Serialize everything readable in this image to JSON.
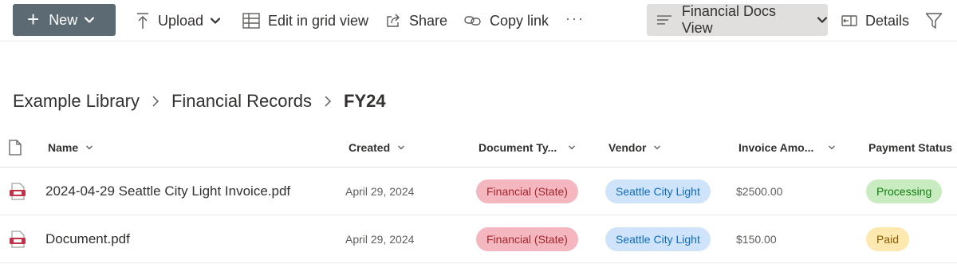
{
  "colors": {
    "new_button_bg": "#5c6b73",
    "view_selector_bg": "#e1dfdd",
    "doc_type_pill_bg": "#f5b7bf",
    "doc_type_pill_text": "#a4262c",
    "vendor_pill_bg": "#cfe4fa",
    "vendor_pill_text": "#0f6cbd",
    "status_processing_bg": "#c8ebc0",
    "status_processing_text": "#107c10",
    "status_paid_bg": "#fde9b0",
    "status_paid_text": "#8a5a00",
    "pdf_icon": "#c4314b"
  },
  "toolbar": {
    "new_label": "New",
    "upload_label": "Upload",
    "edit_grid_label": "Edit in grid view",
    "share_label": "Share",
    "copy_link_label": "Copy link",
    "more_label": "···",
    "view_label": "Financial Docs View",
    "details_label": "Details",
    "icons": [
      "plus-icon",
      "upload-icon",
      "grid-icon",
      "share-icon",
      "link-icon",
      "more-icon",
      "view-lines-icon",
      "details-icon",
      "filter-icon",
      "chevron-down-icon"
    ]
  },
  "breadcrumb": {
    "items": [
      "Example Library",
      "Financial Records"
    ],
    "current": "FY24"
  },
  "list": {
    "columns": {
      "name": "Name",
      "created": "Created",
      "doc_type": "Document Ty...",
      "vendor": "Vendor",
      "amount": "Invoice Amo...",
      "status": "Payment Status"
    },
    "rows": [
      {
        "name": "2024-04-29 Seattle City Light Invoice.pdf",
        "created": "April 29, 2024",
        "doc_type": "Financial (State)",
        "vendor": "Seattle City Light",
        "amount": "$2500.00",
        "status": "Processing",
        "icon": "pdf-file-icon"
      },
      {
        "name": "Document.pdf",
        "created": "April 29, 2024",
        "doc_type": "Financial (State)",
        "vendor": "Seattle City Light",
        "amount": "$150.00",
        "status": "Paid",
        "icon": "pdf-file-icon"
      }
    ]
  }
}
